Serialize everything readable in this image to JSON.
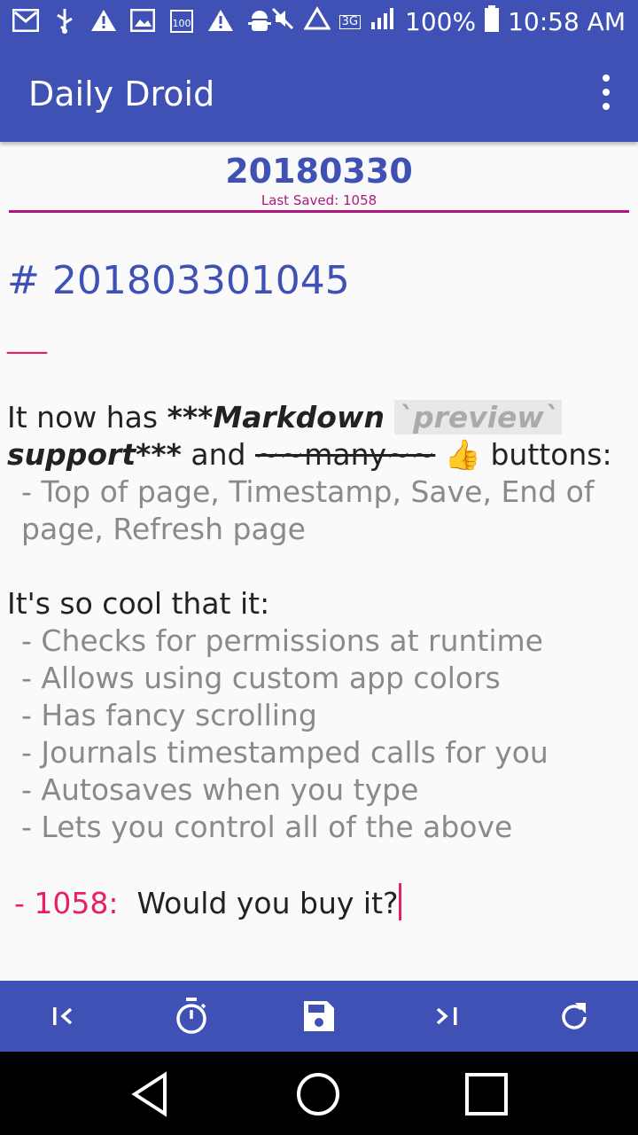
{
  "status_bar": {
    "battery": "100%",
    "time": "10:58 AM",
    "network": "3G",
    "notification_icons": [
      "gmail-icon",
      "usb-icon",
      "alert-icon",
      "image-icon",
      "badge-100-icon",
      "alert-icon",
      "android-debug-icon"
    ],
    "system_icons": [
      "mute-icon",
      "alert-triangle-icon",
      "signal-icon",
      "battery-icon"
    ]
  },
  "toolbar": {
    "title": "Daily Droid",
    "menu_icon": "more-vert-icon"
  },
  "entry": {
    "date": "20180330",
    "last_saved": "Last Saved: 1058"
  },
  "content": {
    "heading": "# 201803301045",
    "hr": "___",
    "p1_pre": "It now has ",
    "p1_bold": "***Markdown ",
    "p1_code": "`preview`",
    "p1_bold2": "support***",
    "p1_and": " and ",
    "p1_strike": "~~many~~",
    "p1_emoji": " 👍 ",
    "p1_post": "buttons:",
    "list1": "- Top of page, Timestamp, Save, End of page, Refresh page",
    "p2": "It's so cool that it:",
    "list2": [
      "- Checks for permissions at runtime",
      "- Allows using custom app colors",
      "- Has fancy scrolling",
      "- Journals timestamped calls for you",
      "- Autosaves when you type",
      "- Lets you control all of the above"
    ],
    "timestamp": "- 1058:",
    "last_line": "Would you buy it?"
  },
  "bottom_bar": [
    "top-of-page-icon",
    "timestamp-icon",
    "save-icon",
    "end-of-page-icon",
    "refresh-icon"
  ],
  "nav_bar": [
    "back-icon",
    "home-icon",
    "recents-icon"
  ],
  "colors": {
    "primary": "#3f51b5",
    "accent": "#e91e63",
    "divider": "#b0177a"
  }
}
